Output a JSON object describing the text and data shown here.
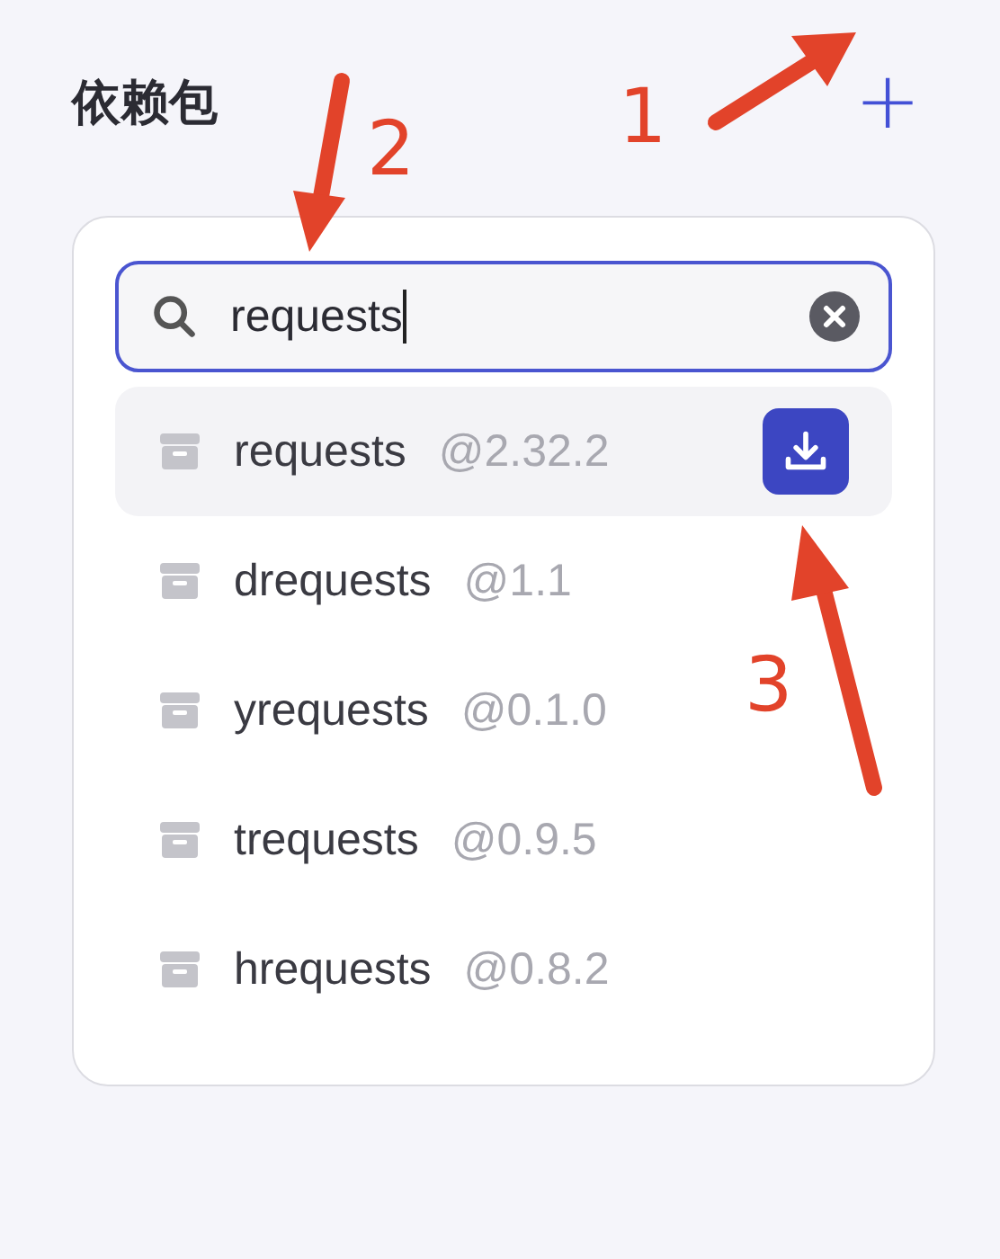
{
  "header": {
    "title": "依赖包",
    "add_button": "+"
  },
  "search": {
    "value": "requests",
    "focused": true
  },
  "packages": [
    {
      "name": "requests",
      "version": "@2.32.2",
      "selected": true
    },
    {
      "name": "drequests",
      "version": "@1.1",
      "selected": false
    },
    {
      "name": "yrequests",
      "version": "@0.1.0",
      "selected": false
    },
    {
      "name": "trequests",
      "version": "@0.9.5",
      "selected": false
    },
    {
      "name": "hrequests",
      "version": "@0.8.2",
      "selected": false
    }
  ],
  "annotations": [
    {
      "label": "1"
    },
    {
      "label": "2"
    },
    {
      "label": "3"
    }
  ]
}
